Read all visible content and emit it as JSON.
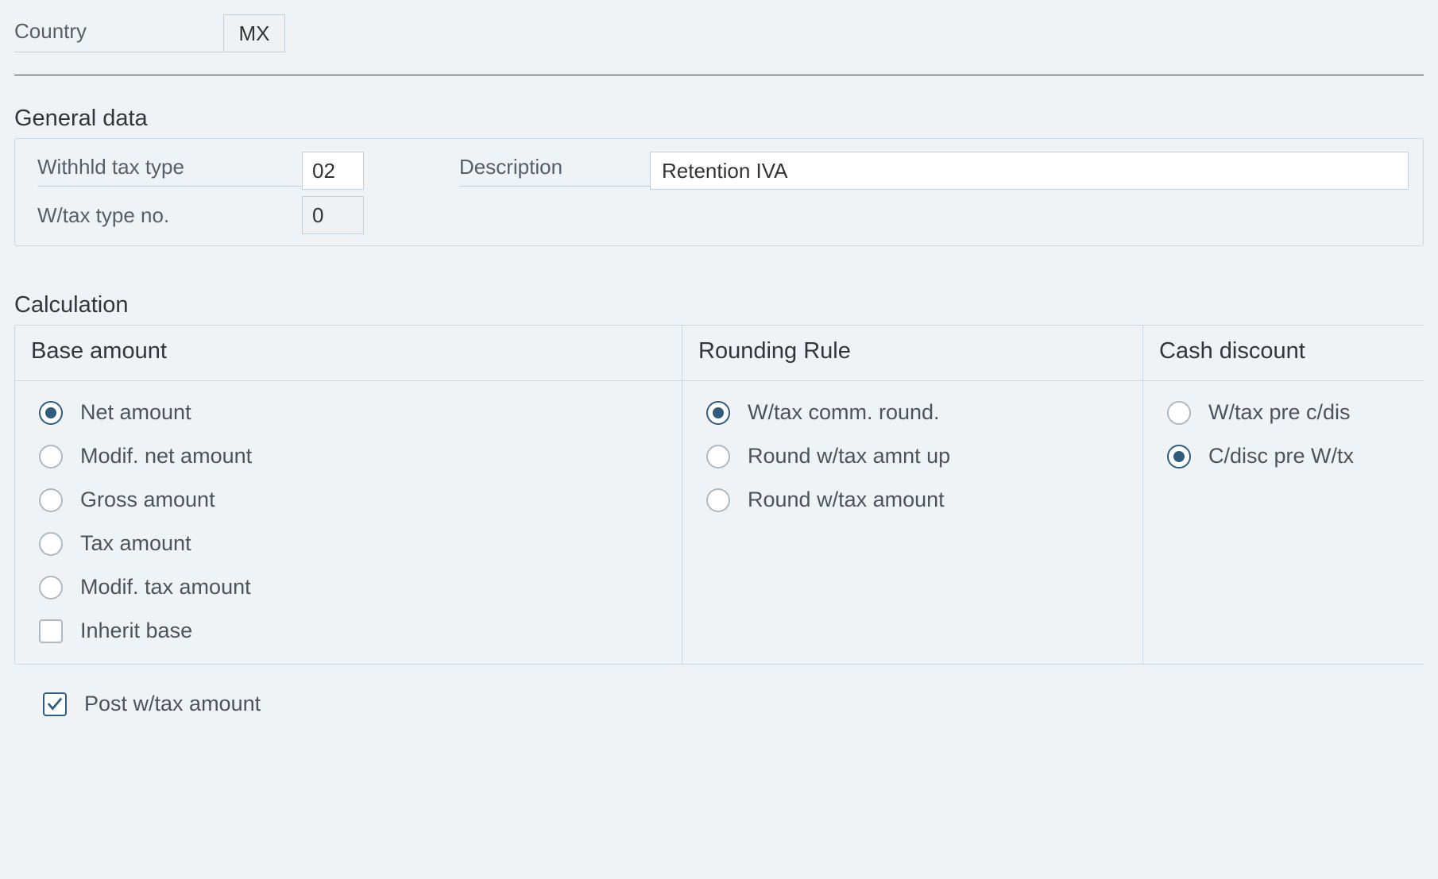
{
  "country": {
    "label": "Country",
    "value": "MX"
  },
  "sections": {
    "general_data": "General data",
    "calculation": "Calculation"
  },
  "general": {
    "withhld_tax_type_label": "Withhld tax type",
    "withhld_tax_type_value": "02",
    "wtax_type_no_label": "W/tax type no.",
    "wtax_type_no_value": "0",
    "description_label": "Description",
    "description_value": "Retention IVA"
  },
  "calculation": {
    "base": {
      "header": "Base amount",
      "options": [
        {
          "label": "Net amount",
          "checked": true
        },
        {
          "label": "Modif. net amount",
          "checked": false
        },
        {
          "label": "Gross amount",
          "checked": false
        },
        {
          "label": "Tax amount",
          "checked": false
        },
        {
          "label": "Modif. tax amount",
          "checked": false
        }
      ],
      "inherit_base": {
        "label": "Inherit base",
        "checked": false
      }
    },
    "rounding": {
      "header": "Rounding Rule",
      "options": [
        {
          "label": "W/tax comm. round.",
          "checked": true
        },
        {
          "label": "Round w/tax amnt up",
          "checked": false
        },
        {
          "label": "Round w/tax amount",
          "checked": false
        }
      ]
    },
    "cash_discount": {
      "header": "Cash discount",
      "options": [
        {
          "label": "W/tax pre c/dis",
          "checked": false
        },
        {
          "label": "C/disc pre W/tx",
          "checked": true
        }
      ]
    },
    "post_wtax_amount": {
      "label": "Post w/tax amount",
      "checked": true
    }
  }
}
